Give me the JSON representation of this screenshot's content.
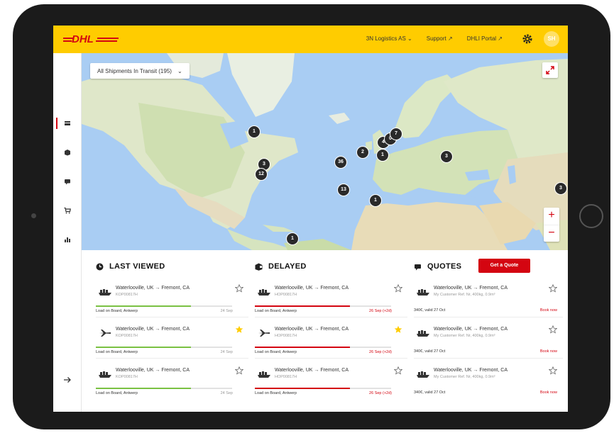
{
  "brand": {
    "logo_text": "DHL",
    "yellow": "#ffcc00",
    "red": "#d40511"
  },
  "header": {
    "account": "3N Logistics AS",
    "support": "Support",
    "portal": "DHLI Portal",
    "avatar_initials": "SH"
  },
  "sidebar": {
    "items": [
      {
        "icon": "shipments-icon",
        "active": true
      },
      {
        "icon": "box-icon",
        "active": false
      },
      {
        "icon": "message-icon",
        "active": false
      },
      {
        "icon": "cart-icon",
        "active": false
      },
      {
        "icon": "analytics-icon",
        "active": false
      }
    ],
    "collapse_icon": "arrow-right-icon"
  },
  "map": {
    "filter_label": "All Shipments In Transit (195)",
    "clusters": [
      "1",
      "3",
      "12",
      "36",
      "2",
      "4",
      "0",
      "7",
      "1",
      "13",
      "1",
      "3",
      "3",
      "1"
    ]
  },
  "last_viewed": {
    "title": "LAST VIEWED",
    "cards": [
      {
        "mode": "ship",
        "route": "Waterlooville, UK → Fremont, CA",
        "ref": "KOP00817H",
        "status": "Load on Board, Antwerp",
        "date": "24 Sep",
        "starred": false,
        "progress": 0.7
      },
      {
        "mode": "plane",
        "route": "Waterlooville, UK → Fremont, CA",
        "ref": "KOP00817H",
        "status": "Load on Board, Antwerp",
        "date": "24 Sep",
        "starred": true,
        "progress": 0.7
      },
      {
        "mode": "ship",
        "route": "Waterlooville, UK → Fremont, CA",
        "ref": "KOP00817H",
        "status": "Load on Board, Antwerp",
        "date": "24 Sep",
        "starred": false,
        "progress": 0.7
      }
    ]
  },
  "delayed": {
    "title": "DELAYED",
    "cards": [
      {
        "mode": "ship",
        "route": "Waterlooville, UK → Fremont, CA",
        "ref": "HOP00817H",
        "status": "Load on Board, Antwerp",
        "date": "26 Sep (+2d)",
        "starred": false,
        "progress": 0.7
      },
      {
        "mode": "plane",
        "route": "Waterlooville, UK → Fremont, CA",
        "ref": "HOP00817H",
        "status": "Load on Board, Antwerp",
        "date": "26 Sep (+2d)",
        "starred": true,
        "progress": 0.7
      },
      {
        "mode": "ship",
        "route": "Waterlooville, UK → Fremont, CA",
        "ref": "HOP00817H",
        "status": "Load on Board, Antwerp",
        "date": "26 Sep (+2d)",
        "starred": false,
        "progress": 0.7
      }
    ]
  },
  "quotes": {
    "title": "QUOTES",
    "cta": "Get a Quote",
    "cards": [
      {
        "route": "Waterlooville, UK → Fremont, CA",
        "details": "My Customer Ref. Nr, 400kg, 0.9m³",
        "price": "340€, valid 27 Oct",
        "action": "Book now"
      },
      {
        "route": "Waterlooville, UK → Fremont, CA",
        "details": "My Customer Ref. Nr, 400kg, 0.9m³",
        "price": "340€, valid 27 Oct",
        "action": "Book now"
      },
      {
        "route": "Waterlooville, UK → Fremont, CA",
        "details": "My Customer Ref. Nr, 400kg, 0.9m³",
        "price": "340€, valid 27 Oct",
        "action": "Book now"
      }
    ]
  }
}
